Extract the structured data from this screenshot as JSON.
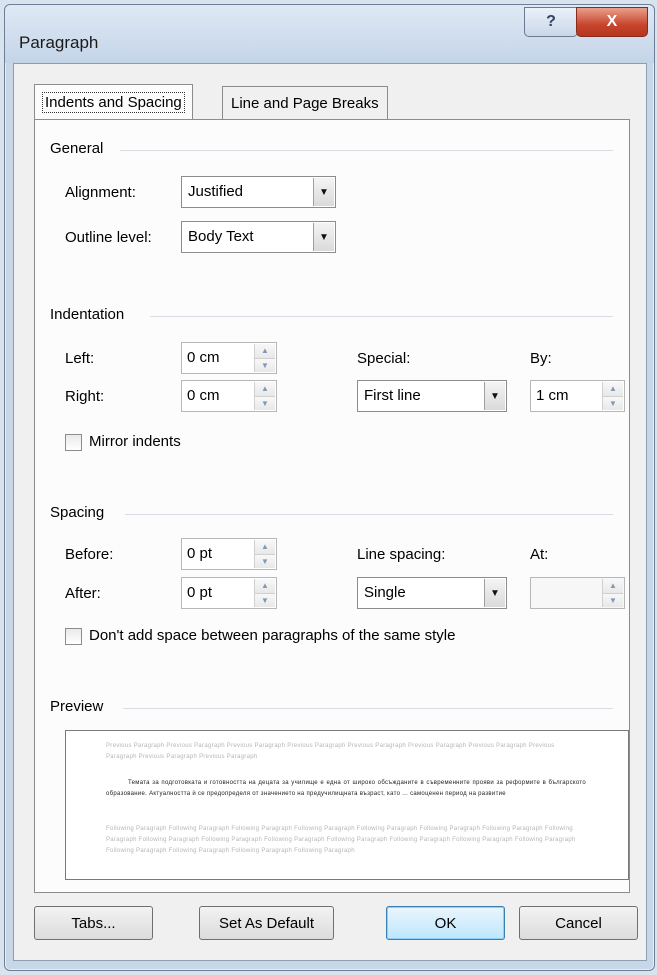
{
  "window": {
    "title": "Paragraph",
    "help_glyph": "?",
    "close_glyph": "X"
  },
  "tabs": [
    {
      "label": "Indents and Spacing",
      "active": true
    },
    {
      "label": "Line and Page Breaks",
      "active": false
    }
  ],
  "general": {
    "label": "General",
    "alignment_label": "Alignment:",
    "alignment_value": "Justified",
    "outline_label": "Outline level:",
    "outline_value": "Body Text"
  },
  "indentation": {
    "label": "Indentation",
    "left_label": "Left:",
    "left_value": "0 cm",
    "right_label": "Right:",
    "right_value": "0 cm",
    "special_label": "Special:",
    "special_value": "First line",
    "by_label": "By:",
    "by_value": "1 cm",
    "mirror_label": "Mirror indents",
    "mirror_checked": false
  },
  "spacing": {
    "label": "Spacing",
    "before_label": "Before:",
    "before_value": "0 pt",
    "after_label": "After:",
    "after_value": "0 pt",
    "line_spacing_label": "Line spacing:",
    "line_spacing_value": "Single",
    "at_label": "At:",
    "at_value": "",
    "dont_add_label": "Don't add space between paragraphs of the same style",
    "dont_add_checked": false
  },
  "preview": {
    "label": "Preview",
    "previous_text": "Previous Paragraph Previous Paragraph Previous Paragraph Previous Paragraph Previous Paragraph Previous Paragraph Previous Paragraph Previous Paragraph Previous Paragraph Previous Paragraph",
    "current_text": "Темата за подготовката и готовността на децата за училище е една от широко обсъжданите в съвременните прояви за реформите в българското образование. Актуалността ѝ се предопределя от значението на предучилищната възраст, като ... самоценен период на развитие",
    "following_text": "Following Paragraph Following Paragraph Following Paragraph Following Paragraph Following Paragraph Following Paragraph Following Paragraph Following Paragraph Following Paragraph Following Paragraph Following Paragraph Following Paragraph Following Paragraph Following Paragraph Following Paragraph Following Paragraph Following Paragraph Following Paragraph Following Paragraph"
  },
  "buttons": {
    "tabs": "Tabs...",
    "set_default": "Set As Default",
    "ok": "OK",
    "cancel": "Cancel"
  },
  "icons": {
    "dropdown": "chevron-down-icon",
    "spin_up": "spin-up-icon",
    "spin_down": "spin-down-icon"
  }
}
